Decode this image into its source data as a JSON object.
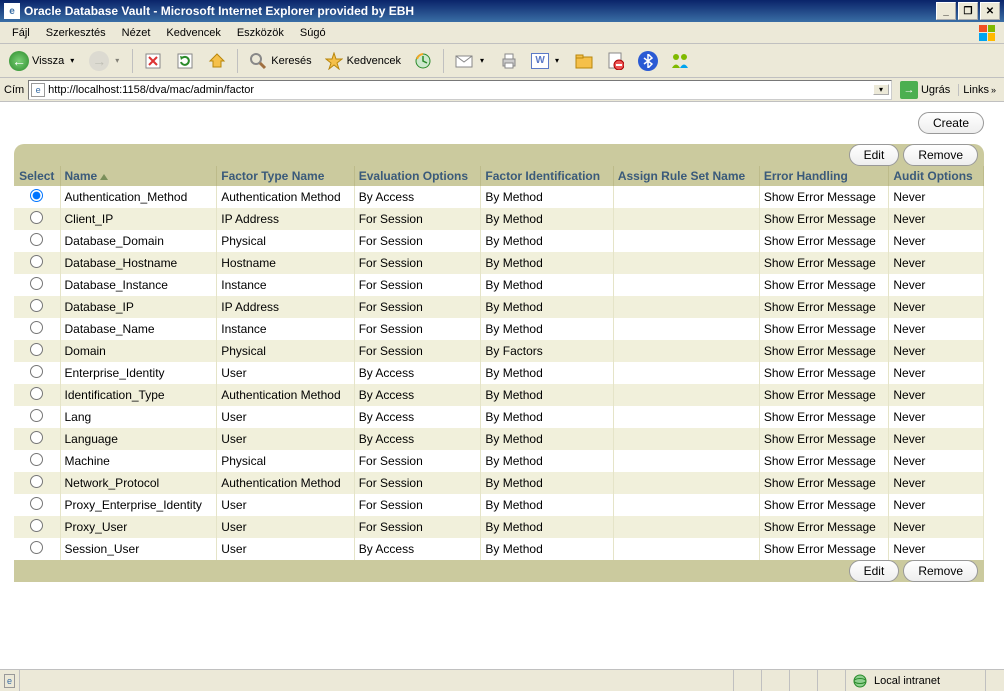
{
  "window": {
    "title": "Oracle Database Vault - Microsoft Internet Explorer provided by EBH"
  },
  "menu": {
    "items": [
      "Fájl",
      "Szerkesztés",
      "Nézet",
      "Kedvencek",
      "Eszközök",
      "Súgó"
    ]
  },
  "toolbar": {
    "back": "Vissza",
    "search": "Keresés",
    "favorites": "Kedvencek"
  },
  "addressbar": {
    "label": "Cím",
    "url": "http://localhost:1158/dva/mac/admin/factor",
    "go": "Ugrás",
    "links": "Links"
  },
  "buttons": {
    "create": "Create",
    "edit": "Edit",
    "remove": "Remove"
  },
  "table": {
    "headers": {
      "select": "Select",
      "name": "Name",
      "factor_type": "Factor Type Name",
      "eval": "Evaluation Options",
      "ident": "Factor Identification",
      "ruleset": "Assign Rule Set Name",
      "error": "Error Handling",
      "audit": "Audit Options"
    },
    "rows": [
      {
        "selected": true,
        "name": "Authentication_Method",
        "type": "Authentication Method",
        "eval": "By Access",
        "ident": "By Method",
        "rule": "",
        "err": "Show Error Message",
        "audit": "Never"
      },
      {
        "selected": false,
        "name": "Client_IP",
        "type": "IP Address",
        "eval": "For Session",
        "ident": "By Method",
        "rule": "",
        "err": "Show Error Message",
        "audit": "Never"
      },
      {
        "selected": false,
        "name": "Database_Domain",
        "type": "Physical",
        "eval": "For Session",
        "ident": "By Method",
        "rule": "",
        "err": "Show Error Message",
        "audit": "Never"
      },
      {
        "selected": false,
        "name": "Database_Hostname",
        "type": "Hostname",
        "eval": "For Session",
        "ident": "By Method",
        "rule": "",
        "err": "Show Error Message",
        "audit": "Never"
      },
      {
        "selected": false,
        "name": "Database_Instance",
        "type": "Instance",
        "eval": "For Session",
        "ident": "By Method",
        "rule": "",
        "err": "Show Error Message",
        "audit": "Never"
      },
      {
        "selected": false,
        "name": "Database_IP",
        "type": "IP Address",
        "eval": "For Session",
        "ident": "By Method",
        "rule": "",
        "err": "Show Error Message",
        "audit": "Never"
      },
      {
        "selected": false,
        "name": "Database_Name",
        "type": "Instance",
        "eval": "For Session",
        "ident": "By Method",
        "rule": "",
        "err": "Show Error Message",
        "audit": "Never"
      },
      {
        "selected": false,
        "name": "Domain",
        "type": "Physical",
        "eval": "For Session",
        "ident": "By Factors",
        "rule": "",
        "err": "Show Error Message",
        "audit": "Never"
      },
      {
        "selected": false,
        "name": "Enterprise_Identity",
        "type": "User",
        "eval": "By Access",
        "ident": "By Method",
        "rule": "",
        "err": "Show Error Message",
        "audit": "Never"
      },
      {
        "selected": false,
        "name": "Identification_Type",
        "type": "Authentication Method",
        "eval": "By Access",
        "ident": "By Method",
        "rule": "",
        "err": "Show Error Message",
        "audit": "Never"
      },
      {
        "selected": false,
        "name": "Lang",
        "type": "User",
        "eval": "By Access",
        "ident": "By Method",
        "rule": "",
        "err": "Show Error Message",
        "audit": "Never"
      },
      {
        "selected": false,
        "name": "Language",
        "type": "User",
        "eval": "By Access",
        "ident": "By Method",
        "rule": "",
        "err": "Show Error Message",
        "audit": "Never"
      },
      {
        "selected": false,
        "name": "Machine",
        "type": "Physical",
        "eval": "For Session",
        "ident": "By Method",
        "rule": "",
        "err": "Show Error Message",
        "audit": "Never"
      },
      {
        "selected": false,
        "name": "Network_Protocol",
        "type": "Authentication Method",
        "eval": "For Session",
        "ident": "By Method",
        "rule": "",
        "err": "Show Error Message",
        "audit": "Never"
      },
      {
        "selected": false,
        "name": "Proxy_Enterprise_Identity",
        "type": "User",
        "eval": "For Session",
        "ident": "By Method",
        "rule": "",
        "err": "Show Error Message",
        "audit": "Never"
      },
      {
        "selected": false,
        "name": "Proxy_User",
        "type": "User",
        "eval": "For Session",
        "ident": "By Method",
        "rule": "",
        "err": "Show Error Message",
        "audit": "Never"
      },
      {
        "selected": false,
        "name": "Session_User",
        "type": "User",
        "eval": "By Access",
        "ident": "By Method",
        "rule": "",
        "err": "Show Error Message",
        "audit": "Never"
      }
    ]
  },
  "status": {
    "zone": "Local intranet"
  }
}
